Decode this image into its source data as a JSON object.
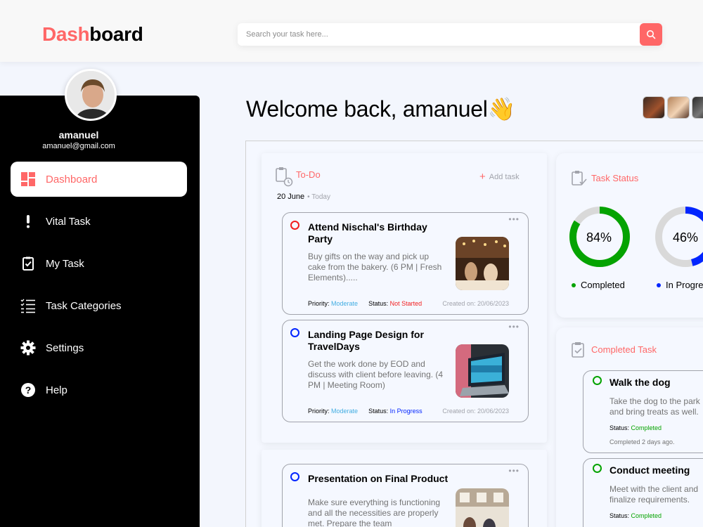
{
  "header": {
    "logo_accent": "Dash",
    "logo_rest": "board",
    "search_placeholder": "Search your task here..."
  },
  "user": {
    "name": "amanuel",
    "email": "amanuel@gmail.com"
  },
  "nav": [
    {
      "label": "Dashboard",
      "icon": "dashboard-icon",
      "active": true
    },
    {
      "label": "Vital Task",
      "icon": "exclamation-icon"
    },
    {
      "label": "My Task",
      "icon": "clipboard-check-icon"
    },
    {
      "label": "Task Categories",
      "icon": "list-icon"
    },
    {
      "label": "Settings",
      "icon": "gear-icon"
    },
    {
      "label": "Help",
      "icon": "help-icon"
    }
  ],
  "welcome": "Welcome back, amanuel👋",
  "todo": {
    "title": "To-Do",
    "add_task": "Add task",
    "date": "20 June",
    "today": "• Today",
    "tasks": [
      {
        "title": "Attend Nischal's Birthday Party",
        "desc": "Buy gifts on the way and pick up cake from the bakery. (6 PM | Fresh Elements).....",
        "priority_label": "Priority: ",
        "priority": "Moderate",
        "status_label": "Status: ",
        "status": "Not Started",
        "created": "Created on: 20/06/2023",
        "circle_color": "#f21e1e"
      },
      {
        "title": "Landing Page Design for TravelDays",
        "desc": "Get the work done by EOD and discuss with client before leaving. (4 PM | Meeting Room)",
        "priority_label": "Priority: ",
        "priority": "Moderate",
        "status_label": "Status: ",
        "status": "In Progress",
        "created": "Created on: 20/06/2023",
        "circle_color": "#0225ff"
      },
      {
        "title": "Presentation on Final Product",
        "desc": "Make sure everything is functioning and all the necessities are properly met. Prepare the team",
        "circle_color": "#0225ff"
      }
    ]
  },
  "task_status": {
    "title": "Task Status",
    "items": [
      {
        "label": "Completed",
        "percent": 84,
        "percent_text": "84%",
        "color": "#05a301"
      },
      {
        "label": "In Progress",
        "percent": 46,
        "percent_text": "46%",
        "color": "#0225ff"
      }
    ]
  },
  "completed": {
    "title": "Completed Task",
    "tasks": [
      {
        "title": "Walk the dog",
        "desc": "Take the dog to the park and bring treats as well.",
        "status_label": "Status: ",
        "status": "Completed",
        "ago": "Completed 2 days ago."
      },
      {
        "title": "Conduct meeting",
        "desc": "Meet with the client and finalize requirements.",
        "status_label": "Status: ",
        "status": "Completed"
      }
    ]
  },
  "colors": {
    "accent": "#ff6767",
    "sidebar": "#000000",
    "completed": "#05a301",
    "in_progress": "#0225ff",
    "not_started": "#f21e1e",
    "moderate": "#42ade2"
  }
}
